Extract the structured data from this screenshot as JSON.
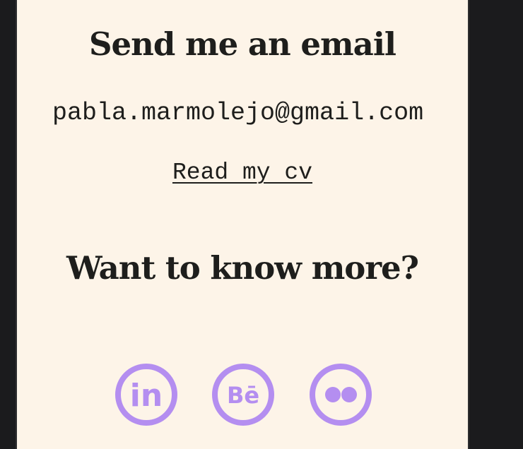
{
  "contact": {
    "email_heading": "Send me an email",
    "email": "pabla.marmolejo@gmail.com",
    "cv_link": "Read my cv"
  },
  "more": {
    "heading": "Want to know more?"
  },
  "social": {
    "items": [
      {
        "icon": "linkedin-icon",
        "label": "in"
      },
      {
        "icon": "behance-icon",
        "label": "Bē"
      },
      {
        "icon": "flickr-icon"
      }
    ]
  },
  "colors": {
    "page_bg": "#1b1b1d",
    "panel_bg": "#fdf4e8",
    "text": "#1e1e1c",
    "icon_accent": "#b48ef0"
  }
}
